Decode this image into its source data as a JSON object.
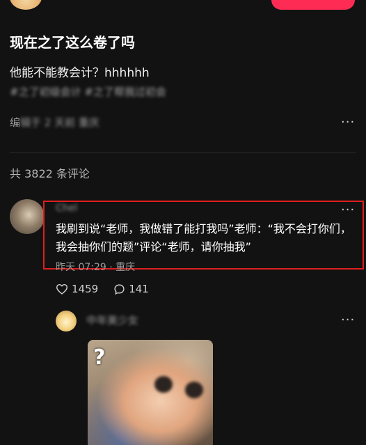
{
  "post": {
    "title": "现在之了这么卷了吗",
    "body": "他能不能教会计？hhhhhh",
    "hashtags": "#之了初级会计 #之了帮我过初会",
    "meta_prefix": "编",
    "meta_blurred": "辑于 2 天前 重庆"
  },
  "comments": {
    "count_label": "共 3822 条评论",
    "items": [
      {
        "username": "Chel",
        "text": "我刷到说“老师，我做错了能打我吗”老师：“我不会打你们，我会抽你们的题”评论“老师，请你抽我”",
        "meta": "昨天 07:29 · 重庆",
        "likes": "1459",
        "replies": "141"
      }
    ],
    "reply": {
      "username": "中年美少女",
      "image_overlay": "?"
    }
  },
  "icons": {
    "more": "more-horizontal-icon",
    "like": "heart-icon",
    "reply": "comment-icon"
  },
  "colors": {
    "background": "#121212",
    "highlight": "#e01e1e",
    "brand": "#fe2c55"
  }
}
